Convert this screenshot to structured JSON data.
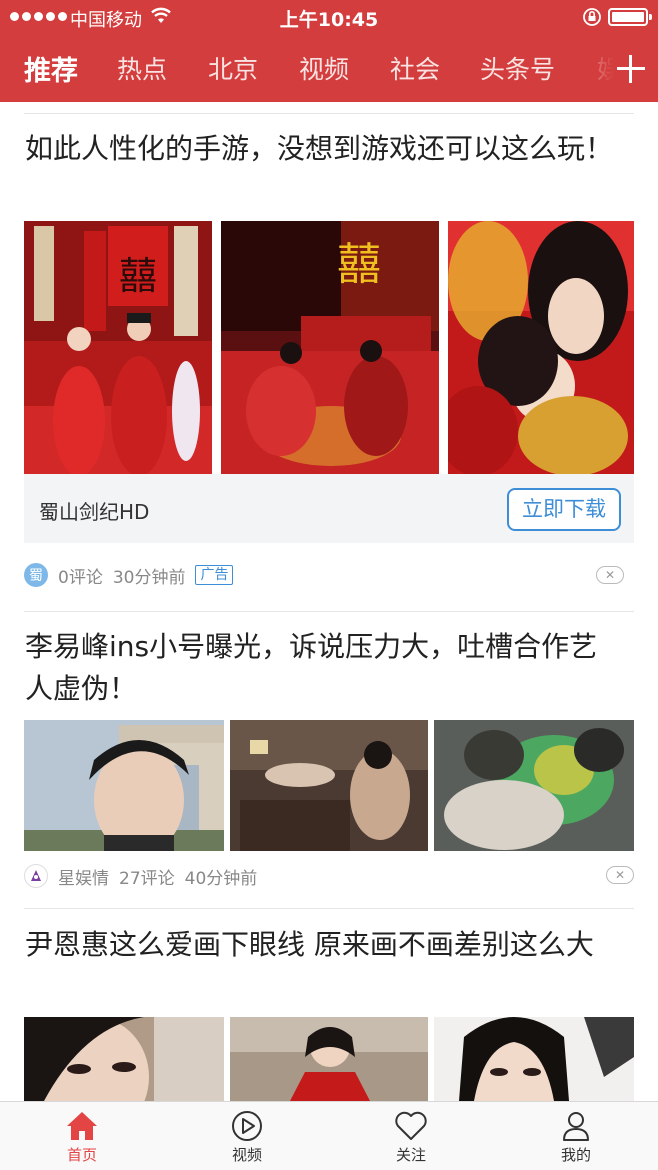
{
  "status_bar": {
    "carrier": "中国移动",
    "time": "上午10:45"
  },
  "tabs": [
    "推荐",
    "热点",
    "北京",
    "视频",
    "社会",
    "头条号",
    "娱"
  ],
  "theme": {
    "brand_red": "#d43d3d",
    "link_blue": "#3d8ed6",
    "nav_active": "#e34444"
  },
  "feed": [
    {
      "title": "如此人性化的手游，没想到游戏还可以这么玩！",
      "ad": {
        "app_name": "蜀山剑纪HD",
        "button": "立即下载"
      },
      "meta": {
        "source_icon_text": "蜀",
        "comments": "0评论",
        "time": "30分钟前",
        "badge": "广告"
      }
    },
    {
      "title": "李易峰ins小号曝光，诉说压力大，吐槽合作艺人虚伪！",
      "meta": {
        "source": "星娱情",
        "comments": "27评论",
        "time": "40分钟前"
      }
    },
    {
      "title": "尹恩惠这么爱画下眼线 原来画不画差别这么大"
    }
  ],
  "bottom_nav": [
    {
      "label": "首页",
      "icon": "home-icon",
      "active": true
    },
    {
      "label": "视频",
      "icon": "play-icon",
      "active": false
    },
    {
      "label": "关注",
      "icon": "heart-icon",
      "active": false
    },
    {
      "label": "我的",
      "icon": "user-icon",
      "active": false
    }
  ]
}
